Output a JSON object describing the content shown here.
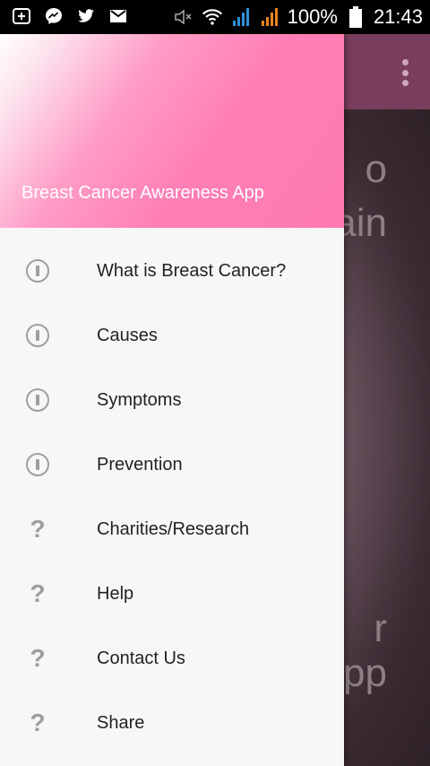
{
  "status_bar": {
    "battery_percent": "100%",
    "time": "21:43",
    "left_icons": [
      "add-box-icon",
      "messenger-icon",
      "twitter-icon",
      "gmail-icon"
    ],
    "right_icons": [
      "mute-icon",
      "wifi-icon",
      "signal-icon-1",
      "signal-icon-2",
      "battery-icon"
    ]
  },
  "drawer": {
    "header_title": "Breast Cancer Awareness App",
    "items": [
      {
        "label": "What is Breast Cancer?",
        "icon": "info-icon"
      },
      {
        "label": "Causes",
        "icon": "info-icon"
      },
      {
        "label": "Symptoms",
        "icon": "info-icon"
      },
      {
        "label": "Prevention",
        "icon": "info-icon"
      },
      {
        "label": "Charities/Research",
        "icon": "help-icon"
      },
      {
        "label": "Help",
        "icon": "help-icon"
      },
      {
        "label": "Contact Us",
        "icon": "help-icon"
      },
      {
        "label": "Share",
        "icon": "help-icon"
      }
    ]
  },
  "background": {
    "visible_fragments": [
      "o",
      "ain",
      "r",
      "pp"
    ]
  },
  "colors": {
    "drawer_header_pink": "#ff7ab2",
    "toolbar_background": "#7a3e5d",
    "icon_grey": "#9e9e9e"
  }
}
